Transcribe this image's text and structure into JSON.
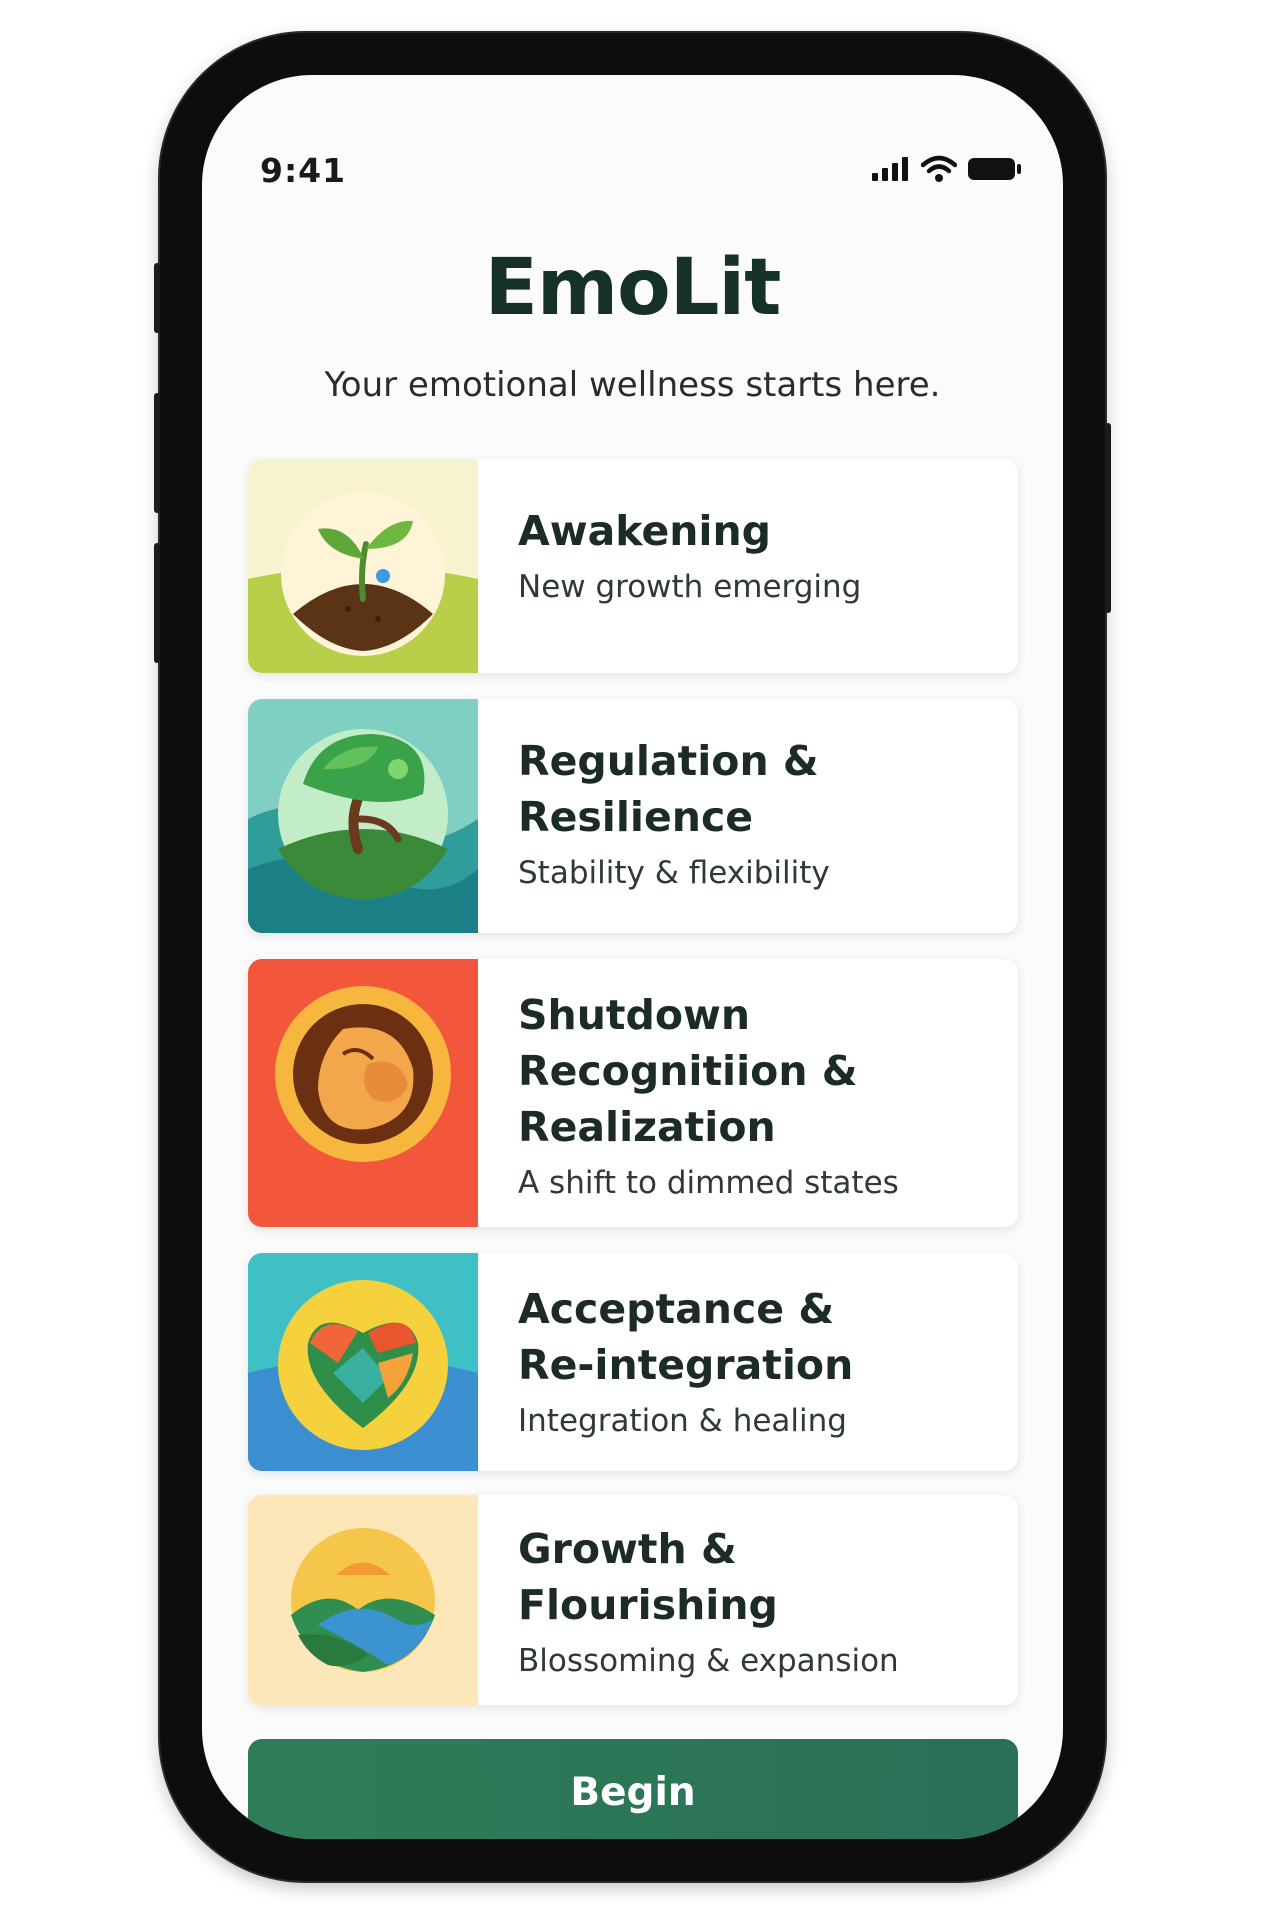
{
  "status_bar": {
    "time": "9:41",
    "signal_icon": "signal-bars-icon",
    "wifi_icon": "wifi-icon",
    "battery_icon": "battery-icon"
  },
  "header": {
    "title": "EmoLit",
    "subtitle": "Your emotional wellness starts here."
  },
  "stages": [
    {
      "title": "Awakening",
      "description": "New growth emerging",
      "icon": "sprout-icon",
      "colors": {
        "background": "#c6d95a",
        "circle": "#fff6dc"
      }
    },
    {
      "title": "Regulation &\nResilience",
      "description": "Stability & flexibility",
      "icon": "tree-icon",
      "colors": {
        "background": "#3aa59a",
        "circle": "#bfe8c6"
      }
    },
    {
      "title": "Shutdown\nRecognitiion &\nRealization",
      "description": "A shift to dimmed states",
      "icon": "curled-figure-icon",
      "colors": {
        "background": "#f35b3e",
        "circle": "#f4b340"
      }
    },
    {
      "title": "Acceptance &\nRe-integration",
      "description": "Integration & healing",
      "icon": "heart-icon",
      "colors": {
        "background": "#3a8fce",
        "circle": "#f7d23e"
      }
    },
    {
      "title": "Growth &\nFlourishing",
      "description": "Blossoming &  expansion",
      "icon": "sunrise-mountain-icon",
      "colors": {
        "background": "#fde9bf",
        "circle": "#f6c64a"
      }
    }
  ],
  "actions": {
    "begin_label": "Begin",
    "accent_color": "#2e7d58"
  }
}
